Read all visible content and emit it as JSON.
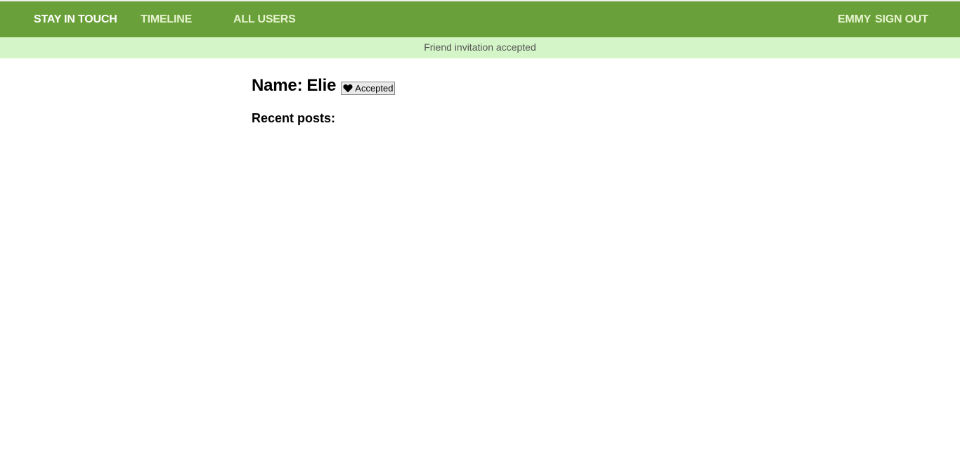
{
  "navbar": {
    "brand": "STAY IN TOUCH",
    "links": {
      "timeline": "TIMELINE",
      "all_users": "ALL USERS"
    },
    "current_user": "EMMY",
    "sign_out": "SIGN OUT",
    "bg_color": "#6aa039"
  },
  "flash": {
    "message": "Friend invitation accepted",
    "bg_color": "#d4f5c7"
  },
  "profile": {
    "name_label": "Name:",
    "name_value": "Elie",
    "status_icon": "heart-icon",
    "status_label": "Accepted",
    "recent_posts_heading": "Recent posts:"
  }
}
